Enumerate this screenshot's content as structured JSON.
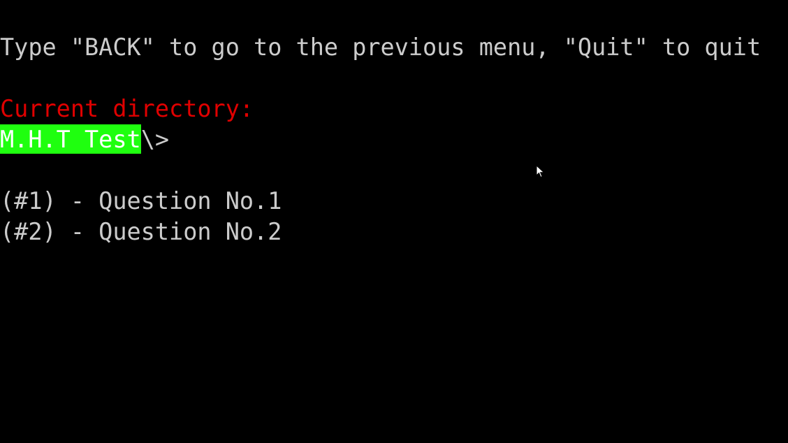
{
  "terminal": {
    "hint_line": "Type \"BACK\" to go to the previous menu, \"Quit\" to quit",
    "current_directory_label": "Current directory:",
    "path_highlighted": "M.H.T Test",
    "path_suffix": "\\>",
    "options": [
      {
        "label": "(#1) - Question No.1"
      },
      {
        "label": "(#2) - Question No.2"
      }
    ],
    "colors": {
      "background": "#000000",
      "text": "#cccccc",
      "label": "#e00000",
      "highlight": "#1fff0f"
    },
    "pointer_icon": "mouse-pointer-icon"
  }
}
